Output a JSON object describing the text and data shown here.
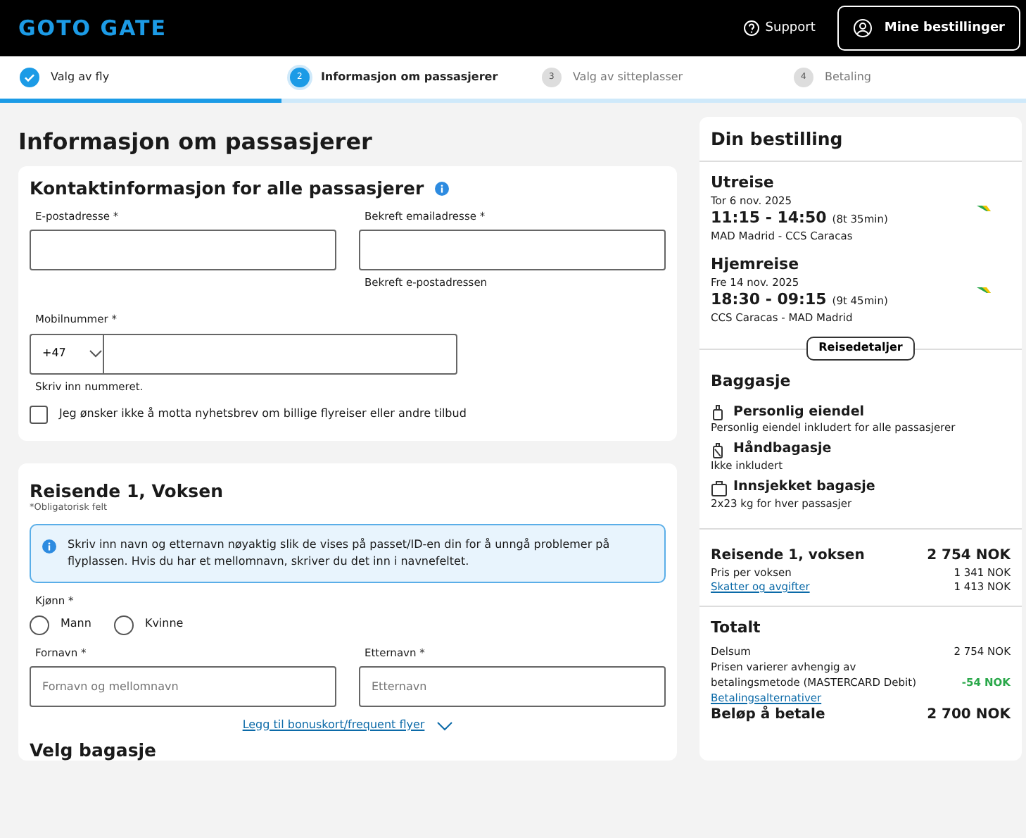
{
  "header": {
    "logo": "GOTO GATE",
    "support": "Support",
    "bookings_button": "Mine bestillinger"
  },
  "steps": [
    {
      "label": "Valg av fly",
      "done": true,
      "selected": false
    },
    {
      "number": "2",
      "label": "Informasjon om passasjerer",
      "done": false,
      "selected": true
    },
    {
      "number": "3",
      "label": "Valg av sitteplasser",
      "done": false,
      "selected": false
    },
    {
      "number": "4",
      "label": "Betaling",
      "done": false,
      "selected": false
    }
  ],
  "progress": {
    "level": 0.275
  },
  "page_title": "Informasjon om passasjerer",
  "contact": {
    "title": "Kontaktinformasjon for alle passasjerer",
    "email": {
      "label": "E-postadresse *"
    },
    "confirm_email": {
      "label": "Bekreft emailadresse *",
      "hint": "Bekreft e-postadressen"
    },
    "phone": {
      "label": "Mobilnummer *",
      "country_code": "+47",
      "hint": "Skriv inn nummeret."
    },
    "newsletter": {
      "label": "Jeg ønsker ikke å motta nyhetsbrev om billige flyreiser eller andre tilbud",
      "checked": false
    }
  },
  "traveller": {
    "title": "Reisende 1, Voksen",
    "required_note": "*Obligatorisk felt",
    "notice": "Skriv inn navn og etternavn nøyaktig slik de vises på passet/ID-en din for å unngå problemer på flyplassen. Hvis du har et mellomnavn, skriver du det inn i navnefeltet.",
    "gender_label": "Kjønn *",
    "genders": [
      {
        "label": "Mann",
        "selected": false
      },
      {
        "label": "Kvinne",
        "selected": false
      }
    ],
    "first_name": {
      "label": "Fornavn *",
      "placeholder": "Fornavn og mellomnavn"
    },
    "last_name": {
      "label": "Etternavn *",
      "placeholder": "Etternavn"
    },
    "bonus_link": "Legg til bonuskort/frequent flyer",
    "next_heading": "Velg bagasje"
  },
  "summary": {
    "title": "Din bestilling",
    "legs": [
      {
        "title": "Utreise",
        "date": "Tor 6 nov. 2025",
        "times": "11:15 - 14:50",
        "duration": "(8t 35min)",
        "route": "MAD Madrid - CCS Caracas"
      },
      {
        "title": "Hjemreise",
        "date": "Fre 14 nov. 2025",
        "times": "18:30 - 09:15",
        "duration": "(9t 45min)",
        "route": "CCS Caracas - MAD Madrid"
      }
    ],
    "details_button": "Reisedetaljer",
    "baggage_title": "Baggasje",
    "baggage": [
      {
        "kind": "personal",
        "title": "Personlig eiendel",
        "text": "Personlig eiendel inkludert for alle passasjerer"
      },
      {
        "kind": "cabin",
        "title": "Håndbagasje",
        "text": "Ikke inkludert"
      },
      {
        "kind": "checked",
        "title": "Innsjekket bagasje",
        "text": "2x23 kg for hver passasjer"
      }
    ],
    "traveller_price": {
      "title": "Reisende 1, voksen",
      "amount": "2 754 NOK",
      "lines": [
        {
          "label": "Pris per voksen",
          "amount": "1 341 NOK",
          "link": false
        },
        {
          "label": "Skatter og avgifter",
          "amount": "1 413 NOK",
          "link": true
        }
      ]
    },
    "total": {
      "title": "Totalt",
      "subtotal_label": "Delsum",
      "subtotal": "2 754 NOK",
      "fee_note": "Prisen varierer avhengig av betalingsmetode (MASTERCARD Debit)",
      "fee": "-54 NOK",
      "options_link": "Betalingsalternativer",
      "pay_label": "Beløp å betale",
      "pay_amount": "2 700 NOK"
    }
  }
}
